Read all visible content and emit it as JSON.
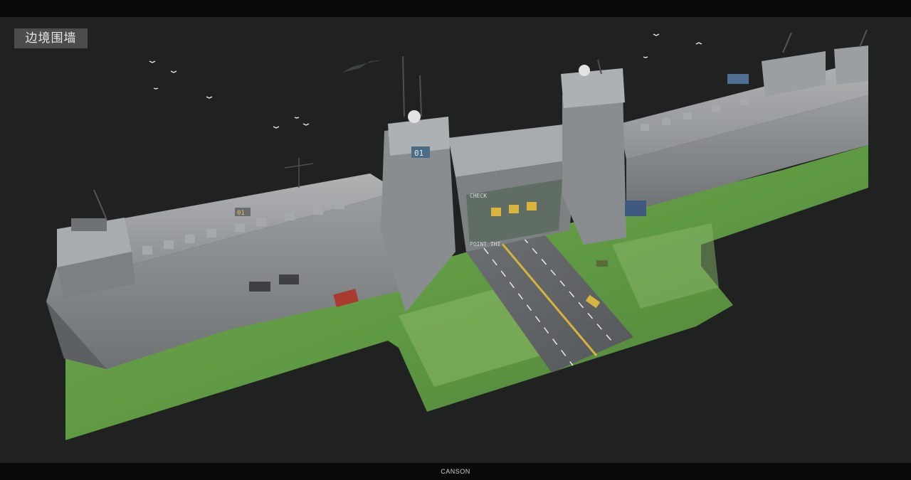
{
  "title_label": "边境围墙",
  "credit": "CANSON",
  "scene_labels": {
    "tower_left_number": "01",
    "tower_number": "01",
    "gate_banner_top": "CHECK",
    "gate_banner_bottom": "POINT THI"
  },
  "colors": {
    "background": "#1f2221",
    "bars": "#0a0a0a",
    "grass": "#6a9a45",
    "concrete": "#8c8f92",
    "road": "#5a5d60",
    "gate": "#5f6d64"
  }
}
